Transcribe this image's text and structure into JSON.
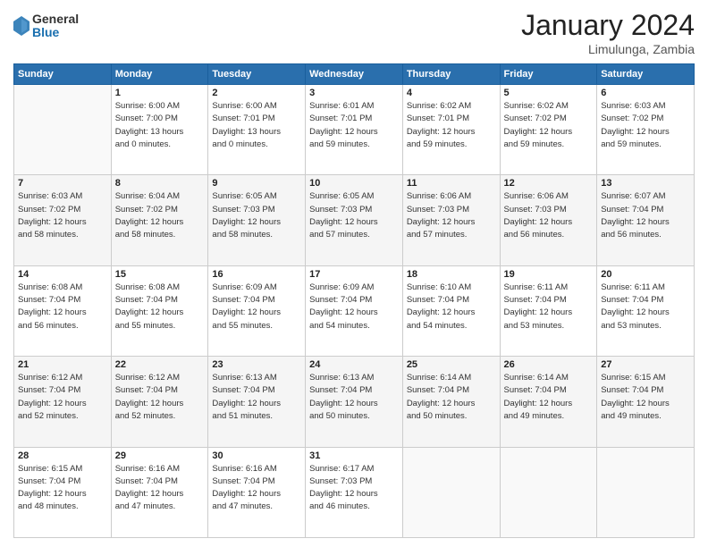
{
  "logo": {
    "general": "General",
    "blue": "Blue"
  },
  "header": {
    "month": "January 2024",
    "location": "Limulunga, Zambia"
  },
  "weekdays": [
    "Sunday",
    "Monday",
    "Tuesday",
    "Wednesday",
    "Thursday",
    "Friday",
    "Saturday"
  ],
  "weeks": [
    [
      {
        "day": "",
        "info": ""
      },
      {
        "day": "1",
        "info": "Sunrise: 6:00 AM\nSunset: 7:00 PM\nDaylight: 13 hours\nand 0 minutes."
      },
      {
        "day": "2",
        "info": "Sunrise: 6:00 AM\nSunset: 7:01 PM\nDaylight: 13 hours\nand 0 minutes."
      },
      {
        "day": "3",
        "info": "Sunrise: 6:01 AM\nSunset: 7:01 PM\nDaylight: 12 hours\nand 59 minutes."
      },
      {
        "day": "4",
        "info": "Sunrise: 6:02 AM\nSunset: 7:01 PM\nDaylight: 12 hours\nand 59 minutes."
      },
      {
        "day": "5",
        "info": "Sunrise: 6:02 AM\nSunset: 7:02 PM\nDaylight: 12 hours\nand 59 minutes."
      },
      {
        "day": "6",
        "info": "Sunrise: 6:03 AM\nSunset: 7:02 PM\nDaylight: 12 hours\nand 59 minutes."
      }
    ],
    [
      {
        "day": "7",
        "info": "Sunrise: 6:03 AM\nSunset: 7:02 PM\nDaylight: 12 hours\nand 58 minutes."
      },
      {
        "day": "8",
        "info": "Sunrise: 6:04 AM\nSunset: 7:02 PM\nDaylight: 12 hours\nand 58 minutes."
      },
      {
        "day": "9",
        "info": "Sunrise: 6:05 AM\nSunset: 7:03 PM\nDaylight: 12 hours\nand 58 minutes."
      },
      {
        "day": "10",
        "info": "Sunrise: 6:05 AM\nSunset: 7:03 PM\nDaylight: 12 hours\nand 57 minutes."
      },
      {
        "day": "11",
        "info": "Sunrise: 6:06 AM\nSunset: 7:03 PM\nDaylight: 12 hours\nand 57 minutes."
      },
      {
        "day": "12",
        "info": "Sunrise: 6:06 AM\nSunset: 7:03 PM\nDaylight: 12 hours\nand 56 minutes."
      },
      {
        "day": "13",
        "info": "Sunrise: 6:07 AM\nSunset: 7:04 PM\nDaylight: 12 hours\nand 56 minutes."
      }
    ],
    [
      {
        "day": "14",
        "info": "Sunrise: 6:08 AM\nSunset: 7:04 PM\nDaylight: 12 hours\nand 56 minutes."
      },
      {
        "day": "15",
        "info": "Sunrise: 6:08 AM\nSunset: 7:04 PM\nDaylight: 12 hours\nand 55 minutes."
      },
      {
        "day": "16",
        "info": "Sunrise: 6:09 AM\nSunset: 7:04 PM\nDaylight: 12 hours\nand 55 minutes."
      },
      {
        "day": "17",
        "info": "Sunrise: 6:09 AM\nSunset: 7:04 PM\nDaylight: 12 hours\nand 54 minutes."
      },
      {
        "day": "18",
        "info": "Sunrise: 6:10 AM\nSunset: 7:04 PM\nDaylight: 12 hours\nand 54 minutes."
      },
      {
        "day": "19",
        "info": "Sunrise: 6:11 AM\nSunset: 7:04 PM\nDaylight: 12 hours\nand 53 minutes."
      },
      {
        "day": "20",
        "info": "Sunrise: 6:11 AM\nSunset: 7:04 PM\nDaylight: 12 hours\nand 53 minutes."
      }
    ],
    [
      {
        "day": "21",
        "info": "Sunrise: 6:12 AM\nSunset: 7:04 PM\nDaylight: 12 hours\nand 52 minutes."
      },
      {
        "day": "22",
        "info": "Sunrise: 6:12 AM\nSunset: 7:04 PM\nDaylight: 12 hours\nand 52 minutes."
      },
      {
        "day": "23",
        "info": "Sunrise: 6:13 AM\nSunset: 7:04 PM\nDaylight: 12 hours\nand 51 minutes."
      },
      {
        "day": "24",
        "info": "Sunrise: 6:13 AM\nSunset: 7:04 PM\nDaylight: 12 hours\nand 50 minutes."
      },
      {
        "day": "25",
        "info": "Sunrise: 6:14 AM\nSunset: 7:04 PM\nDaylight: 12 hours\nand 50 minutes."
      },
      {
        "day": "26",
        "info": "Sunrise: 6:14 AM\nSunset: 7:04 PM\nDaylight: 12 hours\nand 49 minutes."
      },
      {
        "day": "27",
        "info": "Sunrise: 6:15 AM\nSunset: 7:04 PM\nDaylight: 12 hours\nand 49 minutes."
      }
    ],
    [
      {
        "day": "28",
        "info": "Sunrise: 6:15 AM\nSunset: 7:04 PM\nDaylight: 12 hours\nand 48 minutes."
      },
      {
        "day": "29",
        "info": "Sunrise: 6:16 AM\nSunset: 7:04 PM\nDaylight: 12 hours\nand 47 minutes."
      },
      {
        "day": "30",
        "info": "Sunrise: 6:16 AM\nSunset: 7:04 PM\nDaylight: 12 hours\nand 47 minutes."
      },
      {
        "day": "31",
        "info": "Sunrise: 6:17 AM\nSunset: 7:03 PM\nDaylight: 12 hours\nand 46 minutes."
      },
      {
        "day": "",
        "info": ""
      },
      {
        "day": "",
        "info": ""
      },
      {
        "day": "",
        "info": ""
      }
    ]
  ]
}
